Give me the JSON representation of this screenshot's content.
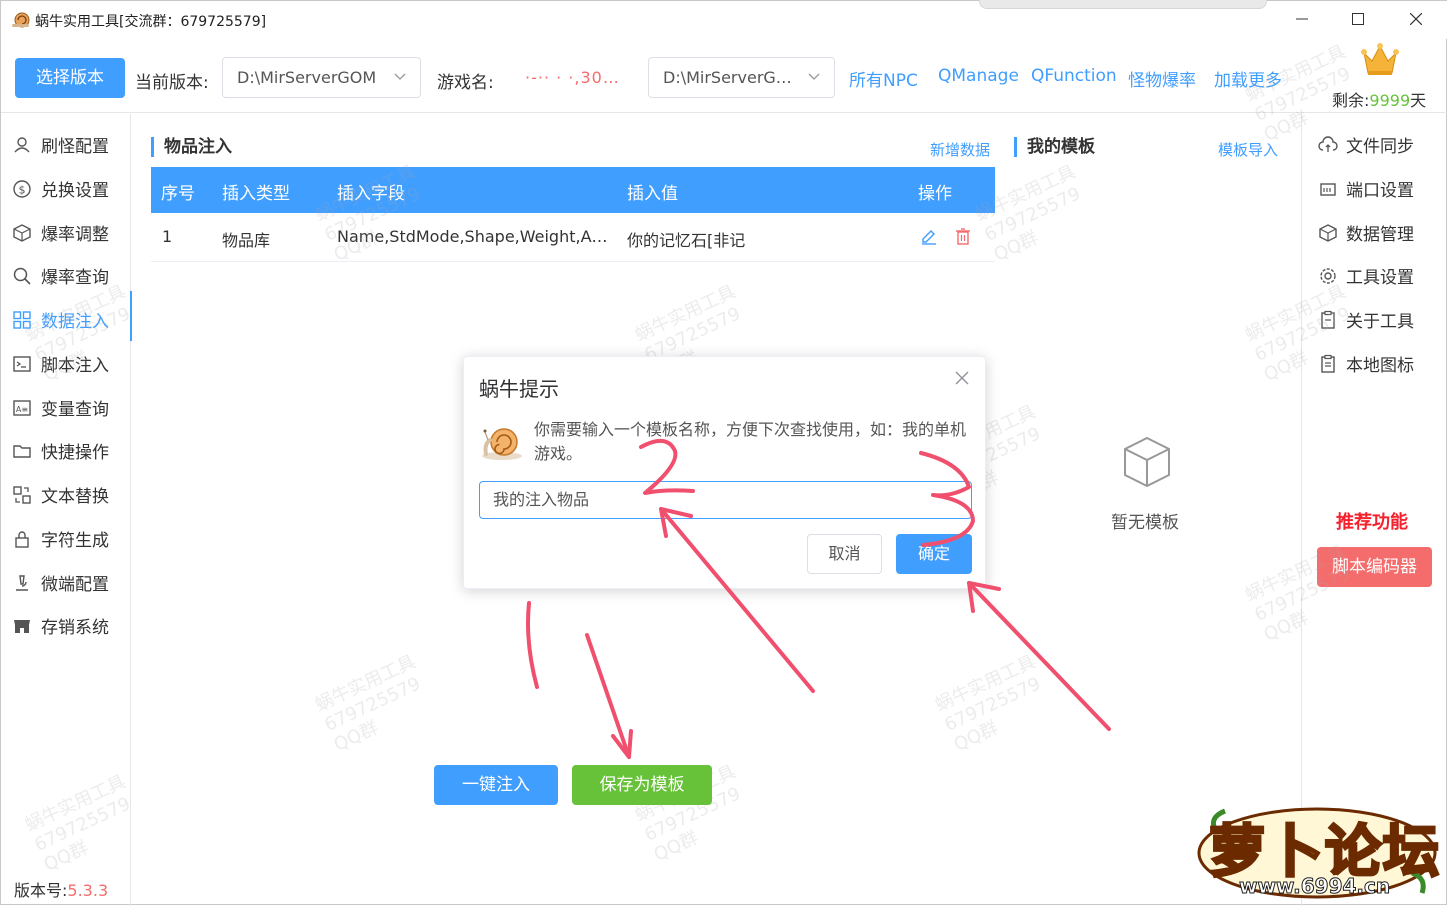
{
  "window": {
    "title": "蜗牛实用工具[交流群：679725579]",
    "min_glyph": "—",
    "max_glyph": "☐",
    "close_glyph": "✕"
  },
  "toolbar": {
    "select_version": "选择版本",
    "current_version_label": "当前版本:",
    "current_version_value": "D:\\MirServerGOM",
    "game_name_label": "游戏名:",
    "game_name_value": "·-·· · ·,30…",
    "game_path_value": "D:\\MirServerG…",
    "links": [
      "所有NPC",
      "QManage",
      "QFunction",
      "怪物爆率",
      "加载更多"
    ],
    "remain_label": "剩余:",
    "remain_value": "9999",
    "remain_unit": "天"
  },
  "sidebar": {
    "items": [
      {
        "label": "刷怪配置",
        "icon": "monster-icon"
      },
      {
        "label": "兑换设置",
        "icon": "dollar-icon"
      },
      {
        "label": "爆率调整",
        "icon": "box-icon"
      },
      {
        "label": "爆率查询",
        "icon": "search-icon"
      },
      {
        "label": "数据注入",
        "icon": "grid-icon",
        "active": true
      },
      {
        "label": "脚本注入",
        "icon": "terminal-icon"
      },
      {
        "label": "变量查询",
        "icon": "variable-icon"
      },
      {
        "label": "快捷操作",
        "icon": "folder-icon"
      },
      {
        "label": "文本替换",
        "icon": "replace-icon"
      },
      {
        "label": "字符生成",
        "icon": "lock-icon"
      },
      {
        "label": "微端配置",
        "icon": "microscope-icon"
      },
      {
        "label": "存销系统",
        "icon": "store-icon"
      }
    ],
    "version_label": "版本号:",
    "version_value": "5.3.3"
  },
  "main": {
    "item_section_title": "物品注入",
    "add_data_link": "新增数据",
    "template_section_title": "我的模板",
    "template_import_link": "模板导入",
    "table": {
      "headers": [
        "序号",
        "插入类型",
        "插入字段",
        "插入值",
        "操作"
      ],
      "rows": [
        {
          "index": "1",
          "type": "物品库",
          "fields": "Name,StdMode,Shape,Weight,A…",
          "value": "你的记忆石[非记"
        }
      ]
    },
    "empty_text": "暂无模板",
    "inject_button": "一键注入",
    "save_template_button": "保存为模板"
  },
  "right_sidebar": {
    "items": [
      {
        "label": "文件同步",
        "icon": "cloud-sync-icon"
      },
      {
        "label": "端口设置",
        "icon": "port-icon"
      },
      {
        "label": "数据管理",
        "icon": "cube-icon"
      },
      {
        "label": "工具设置",
        "icon": "gear-icon"
      },
      {
        "label": "关于工具",
        "icon": "clipboard-icon"
      },
      {
        "label": "本地图标",
        "icon": "clipboard-list-icon"
      }
    ],
    "recommend_title": "推荐功能",
    "encoder_button": "脚本编码器"
  },
  "dialog": {
    "title": "蜗牛提示",
    "message": "你需要输入一个模板名称，方便下次查找使用，如：我的单机游戏。",
    "input_value": "我的注入物品",
    "cancel": "取消",
    "ok": "确定"
  },
  "watermark": {
    "text": "蜗牛实用工具\n679725579\nQQ群"
  },
  "logo": {
    "text": "萝卜论坛",
    "url": "www.6994.cn"
  },
  "colors": {
    "primary": "#409eff",
    "success": "#67c23a",
    "danger": "#f56c6c",
    "annotation": "#f0506e"
  }
}
